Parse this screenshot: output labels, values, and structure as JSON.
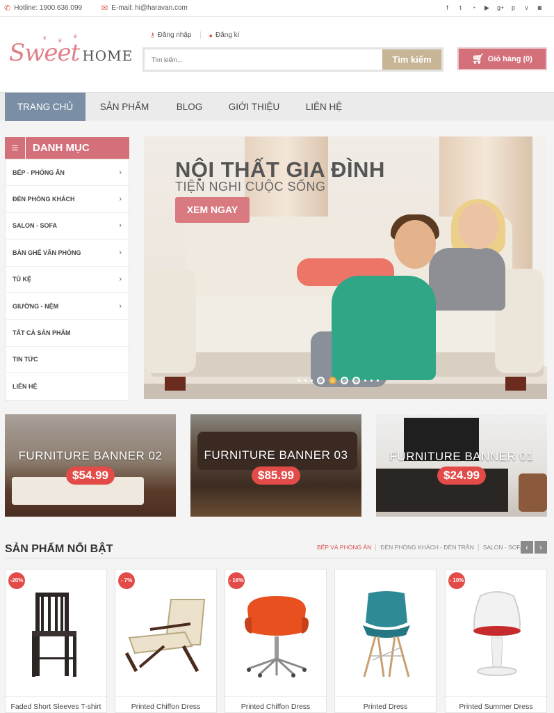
{
  "topbar": {
    "hotline": "Hotline: 1900.636.099",
    "email": "E-mail: hi@haravan.com",
    "social_icons": [
      "facebook-icon",
      "twitter-icon",
      "rss-icon",
      "youtube-icon",
      "google-plus-icon",
      "pinterest-icon",
      "vimeo-icon",
      "instagram-icon"
    ]
  },
  "header": {
    "logo_script": "Sweet",
    "logo_word": "HOME",
    "login": "Đăng nhập",
    "register": "Đăng kí",
    "search_placeholder": "Tìm kiếm...",
    "search_button": "Tìm kiếm",
    "cart": "Giỏ hàng (0)"
  },
  "nav": {
    "items": [
      "TRANG CHỦ",
      "SẢN PHẨM",
      "BLOG",
      "GIỚI THIỆU",
      "LIÊN HỆ"
    ],
    "active": "TRANG CHỦ"
  },
  "sidebar": {
    "title": "DANH MỤC",
    "items": [
      {
        "label": "BẾP - PHÒNG ĂN",
        "has_children": true
      },
      {
        "label": "ĐÈN PHÒNG KHÁCH",
        "has_children": true
      },
      {
        "label": "SALON - SOFA",
        "has_children": true
      },
      {
        "label": "BÀN GHẾ VĂN PHÒNG",
        "has_children": true
      },
      {
        "label": "TỦ KỆ",
        "has_children": true
      },
      {
        "label": "GIƯỜNG - NỆM",
        "has_children": true
      },
      {
        "label": "TẤT CẢ SẢN PHẨM",
        "has_children": false
      },
      {
        "label": "TIN TỨC",
        "has_children": false
      },
      {
        "label": "LIÊN HỆ",
        "has_children": false
      }
    ]
  },
  "hero": {
    "title": "NỘI THẤT GIA ĐÌNH",
    "subtitle": "TIỆN NGHI CUỘC SỐNG",
    "cta": "XEM NGAY",
    "active_slide": 2
  },
  "banners": [
    {
      "label": "FURNITURE BANNER 02",
      "price": "$54.99"
    },
    {
      "label": "FURNITURE BANNER 03",
      "price": "$85.99"
    },
    {
      "label": "FURNITURE BANNER 01",
      "price": "$24.99"
    }
  ],
  "featured": {
    "title": "SẢN PHẨM NỔI BẬT",
    "tabs": [
      "BẾP VÀ PHÒNG ĂN",
      "ĐÈN PHÒNG KHÁCH - ĐÈN TRẦN",
      "SALON - SOFA"
    ],
    "prev": "‹",
    "next": "›",
    "products": [
      {
        "name": "Faded Short Sleeves T-shirt",
        "badge": "-20%",
        "icon": "metal-chair"
      },
      {
        "name": "Printed Chiffon Dress",
        "badge": "- 7%",
        "icon": "lounge-chair"
      },
      {
        "name": "Printed Chiffon Dress",
        "badge": "- 16%",
        "icon": "orange-office-chair"
      },
      {
        "name": "Printed Dress",
        "badge": "",
        "icon": "eames-chair"
      },
      {
        "name": "Printed Summer Dress",
        "badge": "- 10%",
        "icon": "tulip-chair"
      }
    ]
  },
  "colors": {
    "accent": "#d4707a",
    "nav_active": "#7a8fa5",
    "search_button": "#c8b596",
    "badge": "#e34b48"
  }
}
